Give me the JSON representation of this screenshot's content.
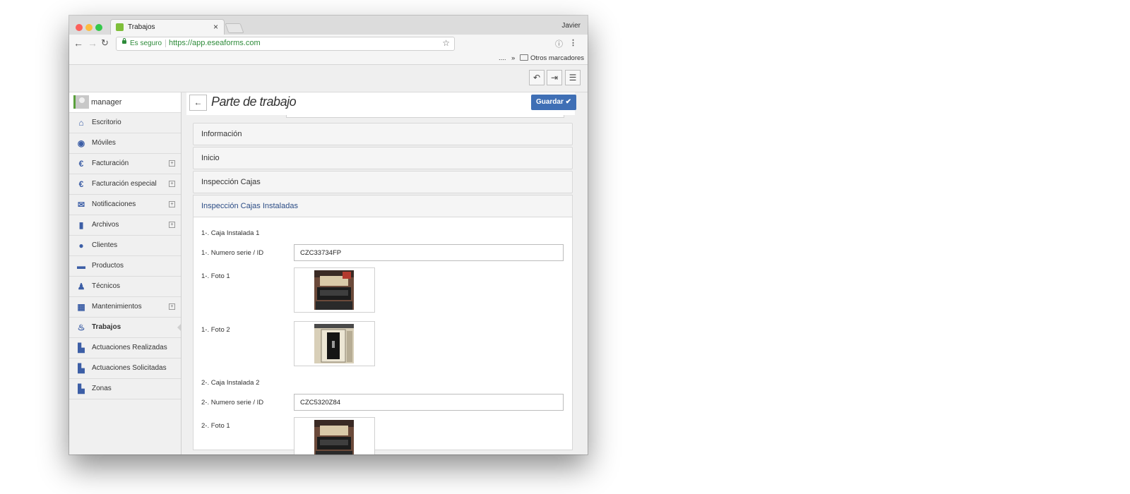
{
  "browser": {
    "tab_title": "Trabajos",
    "tab_close": "×",
    "profile": "Javier",
    "secure_label": "Es seguro",
    "url": "https://app.eseaforms.com",
    "bookmarks_more": "....",
    "bookmarks_chevron": "»",
    "other_bookmarks": "Otros marcadores"
  },
  "user": {
    "name": "manager"
  },
  "sidebar": {
    "items": [
      {
        "label": "Escritorio",
        "icon": "home-icon",
        "expandable": false,
        "active": false
      },
      {
        "label": "Móviles",
        "icon": "android-icon",
        "expandable": false,
        "active": false
      },
      {
        "label": "Facturación",
        "icon": "euro-icon",
        "expandable": true,
        "active": false
      },
      {
        "label": "Facturación especial",
        "icon": "euro-icon",
        "expandable": true,
        "active": false
      },
      {
        "label": "Notificaciones",
        "icon": "envelope-icon",
        "expandable": true,
        "active": false
      },
      {
        "label": "Archivos",
        "icon": "book-icon",
        "expandable": true,
        "active": false
      },
      {
        "label": "Clientes",
        "icon": "users-icon",
        "expandable": false,
        "active": false
      },
      {
        "label": "Productos",
        "icon": "cart-icon",
        "expandable": false,
        "active": false
      },
      {
        "label": "Técnicos",
        "icon": "person-icon",
        "expandable": false,
        "active": false
      },
      {
        "label": "Mantenimientos",
        "icon": "calendar-icon",
        "expandable": true,
        "active": false
      },
      {
        "label": "Trabajos",
        "icon": "fire-icon",
        "expandable": false,
        "active": true
      },
      {
        "label": "Actuaciones Realizadas",
        "icon": "file-icon",
        "expandable": false,
        "active": false
      },
      {
        "label": "Actuaciones Solicitadas",
        "icon": "file-icon",
        "expandable": false,
        "active": false
      },
      {
        "label": "Zonas",
        "icon": "file-icon",
        "expandable": false,
        "active": false
      }
    ]
  },
  "page": {
    "title": "Parte de trabajo",
    "save_label": "Guardar ✔",
    "sections": [
      "Información",
      "Inicio",
      "Inspección Cajas"
    ],
    "open_section": "Inspección Cajas Instaladas",
    "fields": {
      "caja1_heading": "1-. Caja Instalada 1",
      "serial1_label": "1-. Numero serie / ID",
      "serial1_value": "CZC33734FP",
      "foto1_1_label": "1-. Foto 1",
      "foto1_2_label": "1-. Foto 2",
      "caja2_heading": "2-. Caja Instalada 2",
      "serial2_label": "2-. Numero serie / ID",
      "serial2_value": "CZC5320Z84",
      "foto2_1_label": "2-. Foto 1"
    }
  },
  "colors": {
    "accent": "#3f6fb5",
    "secure_green": "#2e8b3a",
    "icon_blue": "#3c5ea6"
  }
}
